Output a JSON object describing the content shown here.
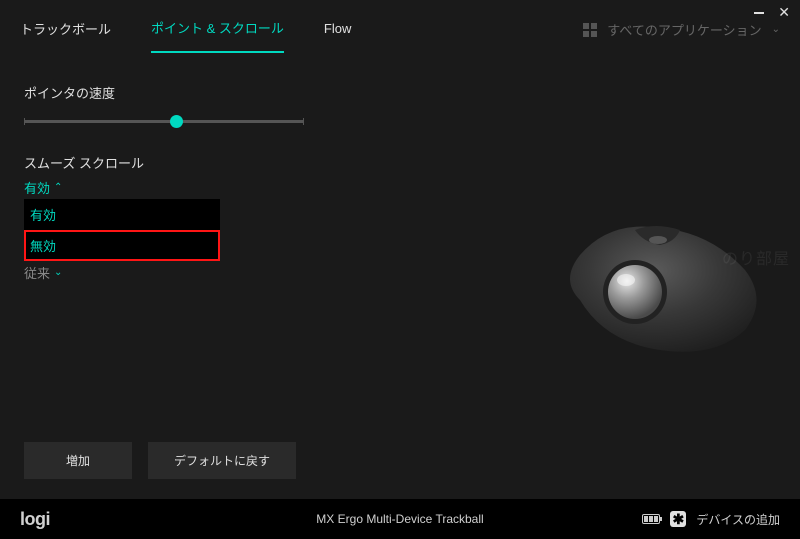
{
  "tabs": {
    "trackball": "トラックボール",
    "point_scroll": "ポイント & スクロール",
    "flow": "Flow"
  },
  "app_filter_label": "すべてのアプリケーション",
  "pointer_speed_label": "ポインタの速度",
  "smooth_scroll": {
    "label": "スムーズ スクロール",
    "selected": "有効",
    "options": [
      "有効",
      "無効"
    ]
  },
  "hidden_row_label": "従来",
  "buttons": {
    "increase": "増加",
    "restore_default": "デフォルトに戻す"
  },
  "footer": {
    "brand": "logi",
    "device": "MX Ergo Multi-Device Trackball",
    "add_device": "デバイスの追加"
  },
  "watermark": "のり部屋"
}
